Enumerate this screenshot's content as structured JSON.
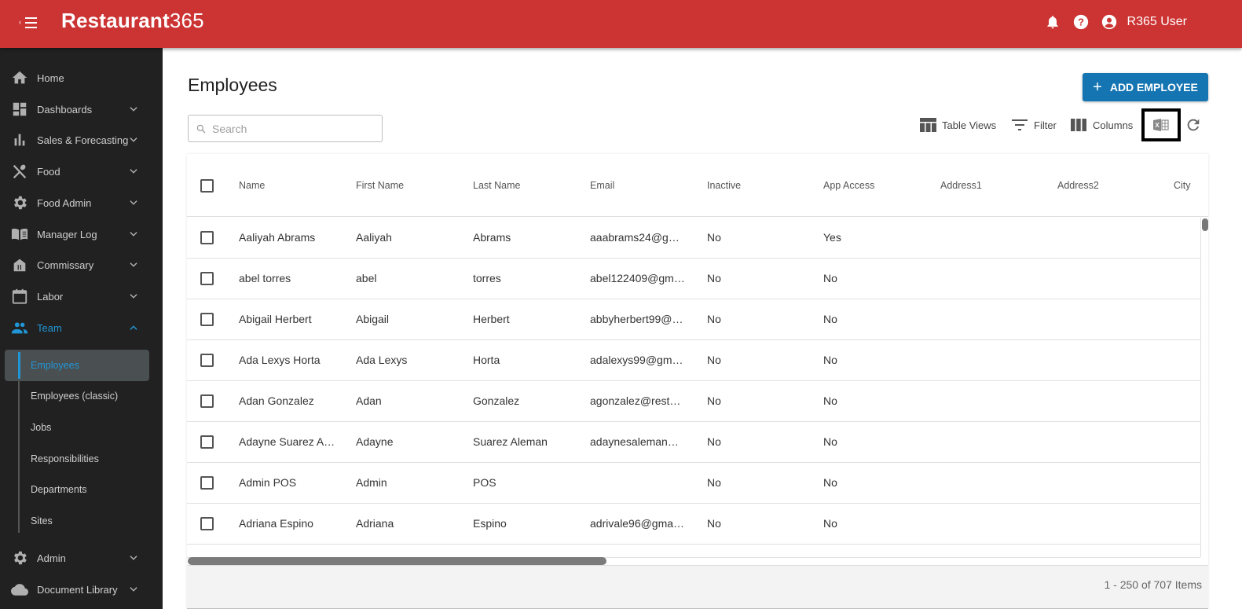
{
  "app": {
    "logo_bold": "Restaurant",
    "logo_thin": "365",
    "brand_color": "#cc3333",
    "user_name": "R365 User"
  },
  "sidebar": {
    "items": [
      {
        "label": "Home",
        "icon": "home-icon",
        "expandable": false
      },
      {
        "label": "Dashboards",
        "icon": "dashboard-icon",
        "expandable": true
      },
      {
        "label": "Sales & Forecasting",
        "icon": "bar-chart-icon",
        "expandable": true
      },
      {
        "label": "Food",
        "icon": "utensils-icon",
        "expandable": true
      },
      {
        "label": "Food Admin",
        "icon": "gear-icon",
        "expandable": true
      },
      {
        "label": "Manager Log",
        "icon": "book-icon",
        "expandable": true
      },
      {
        "label": "Commissary",
        "icon": "store-icon",
        "expandable": true
      },
      {
        "label": "Labor",
        "icon": "calendar-icon",
        "expandable": true
      },
      {
        "label": "Team",
        "icon": "people-icon",
        "expandable": true,
        "expanded": true
      },
      {
        "label": "Admin",
        "icon": "gear-icon",
        "expandable": true
      },
      {
        "label": "Document Library",
        "icon": "cloud-icon",
        "expandable": true
      }
    ],
    "team_subitems": [
      {
        "label": "Employees",
        "selected": true
      },
      {
        "label": "Employees (classic)"
      },
      {
        "label": "Jobs"
      },
      {
        "label": "Responsibilities"
      },
      {
        "label": "Departments"
      },
      {
        "label": "Sites"
      }
    ],
    "active_color": "#2196d6"
  },
  "page": {
    "title": "Employees",
    "add_button": "ADD EMPLOYEE",
    "search_placeholder": "Search",
    "search_value": "",
    "toolbar": {
      "table_views": "Table Views",
      "filter": "Filter",
      "columns": "Columns"
    }
  },
  "table": {
    "columns": [
      "Name",
      "First Name",
      "Last Name",
      "Email",
      "Inactive",
      "App Access",
      "Address1",
      "Address2",
      "City"
    ],
    "rows": [
      [
        "Aaliyah Abrams",
        "Aaliyah",
        "Abrams",
        "aaabrams24@g…",
        "No",
        "Yes",
        "",
        "",
        ""
      ],
      [
        "abel torres",
        "abel",
        "torres",
        "abel122409@gm…",
        "No",
        "No",
        "",
        "",
        ""
      ],
      [
        "Abigail Herbert",
        "Abigail",
        "Herbert",
        "abbyherbert99@…",
        "No",
        "No",
        "",
        "",
        ""
      ],
      [
        "Ada Lexys Horta",
        "Ada Lexys",
        "Horta",
        "adalexys99@gm…",
        "No",
        "No",
        "",
        "",
        ""
      ],
      [
        "Adan Gonzalez",
        "Adan",
        "Gonzalez",
        "agonzalez@rest…",
        "No",
        "No",
        "",
        "",
        ""
      ],
      [
        "Adayne Suarez A…",
        "Adayne",
        "Suarez Aleman",
        "adaynesaleman…",
        "No",
        "No",
        "",
        "",
        ""
      ],
      [
        "Admin POS",
        "Admin",
        "POS",
        "",
        "No",
        "No",
        "",
        "",
        ""
      ],
      [
        "Adriana Espino",
        "Adriana",
        "Espino",
        "adrivale96@gma…",
        "No",
        "No",
        "",
        "",
        ""
      ],
      [
        "",
        "",
        "",
        "",
        "",
        "",
        "",
        "",
        ""
      ]
    ],
    "pager": "1 - 250 of 707 Items"
  }
}
